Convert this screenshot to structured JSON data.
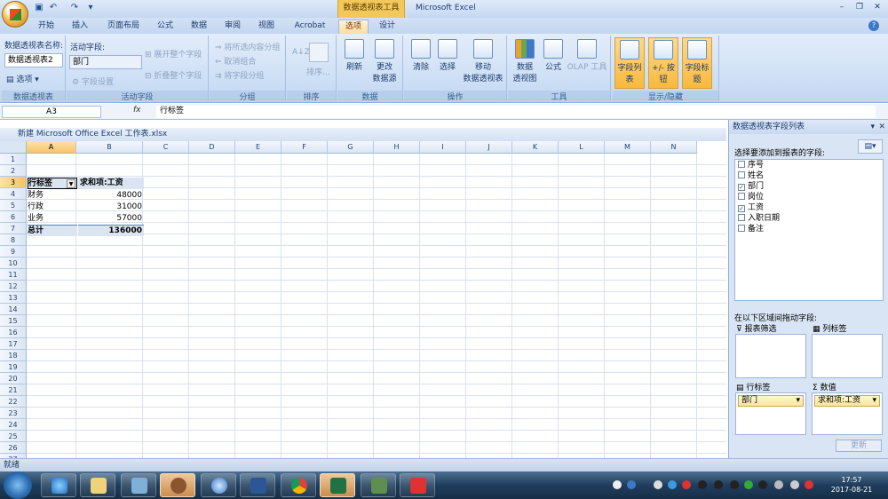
{
  "window": {
    "app_title": "Microsoft Excel",
    "context_tab": "数据透视表工具"
  },
  "tabs": [
    "开始",
    "插入",
    "页面布局",
    "公式",
    "数据",
    "审阅",
    "视图",
    "Acrobat",
    "选项",
    "设计"
  ],
  "active_tab": "选项",
  "ribbon": {
    "pivot_table": {
      "name_label": "数据透视表名称:",
      "name_value": "数据透视表2",
      "options_label": "选项",
      "group_label": "数据透视表"
    },
    "active_field": {
      "label": "活动字段:",
      "value": "部门",
      "field_settings": "字段设置",
      "expand": "展开整个字段",
      "collapse": "折叠整个字段",
      "group_label": "活动字段"
    },
    "grouping": {
      "group_sel": "将所选内容分组",
      "ungroup": "取消组合",
      "group_field": "将字段分组",
      "group_label": "分组"
    },
    "sort": {
      "az": "A↓Z",
      "label": "排序...",
      "group_label": "排序"
    },
    "data": {
      "refresh": "刷新",
      "change_source_1": "更改",
      "change_source_2": "数据源",
      "group_label": "数据"
    },
    "actions": {
      "clear": "清除",
      "select": "选择",
      "move_1": "移动",
      "move_2": "数据透视表",
      "group_label": "操作"
    },
    "tools": {
      "pivot_chart_1": "数据",
      "pivot_chart_2": "透视图",
      "formulas": "公式",
      "olap": "OLAP 工具",
      "group_label": "工具"
    },
    "show_hide": {
      "field_list": "字段列表",
      "buttons": "+/- 按钮",
      "headers": "字段标题",
      "group_label": "显示/隐藏"
    }
  },
  "formula_bar": {
    "name_box": "A3",
    "fx": "fx",
    "content": "行标签"
  },
  "workbook": {
    "title": "新建 Microsoft Office Excel 工作表.xlsx"
  },
  "columns": [
    "A",
    "B",
    "C",
    "D",
    "E",
    "F",
    "G",
    "H",
    "I",
    "J",
    "K",
    "L",
    "M",
    "N"
  ],
  "rows": [
    "1",
    "2",
    "3",
    "4",
    "5",
    "6",
    "7",
    "8",
    "9",
    "10",
    "11",
    "12",
    "13",
    "14",
    "15",
    "16",
    "17",
    "18",
    "19",
    "20",
    "21",
    "22",
    "23",
    "24",
    "25",
    "26",
    "27"
  ],
  "pivot": {
    "row_label": "行标签",
    "value_label": "求和项:工资",
    "data": [
      {
        "name": "财务",
        "value": "48000"
      },
      {
        "name": "行政",
        "value": "31000"
      },
      {
        "name": "业务",
        "value": "57000"
      }
    ],
    "total_label": "总计",
    "total_value": "136000"
  },
  "pane": {
    "title": "数据透视表字段列表",
    "choose_fields": "选择要添加到报表的字段:",
    "fields": [
      {
        "name": "序号",
        "checked": false
      },
      {
        "name": "姓名",
        "checked": false
      },
      {
        "name": "部门",
        "checked": true
      },
      {
        "name": "岗位",
        "checked": false
      },
      {
        "name": "工资",
        "checked": true
      },
      {
        "name": "入职日期",
        "checked": false
      },
      {
        "name": "备注",
        "checked": false
      }
    ],
    "drag_label": "在以下区域间拖动字段:",
    "report_filter": "报表筛选",
    "column_labels": "列标签",
    "row_labels": "行标签",
    "values": "数值",
    "row_item": "部门",
    "value_item": "求和项:工资",
    "update": "更新"
  },
  "status": {
    "text": "就绪"
  },
  "clock": {
    "time": "17:57",
    "date": "2017-08-21"
  }
}
